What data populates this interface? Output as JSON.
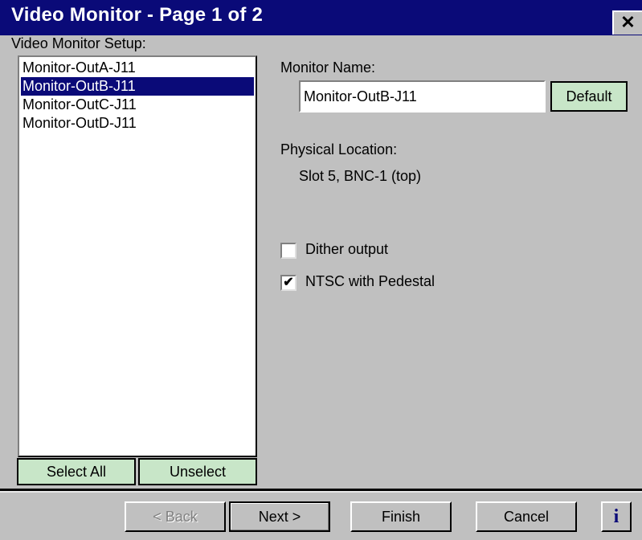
{
  "window": {
    "title": "Video Monitor - Page 1 of 2",
    "close_glyph": "✕"
  },
  "setup": {
    "label": "Video Monitor Setup:",
    "items": [
      "Monitor-OutA-J11",
      "Monitor-OutB-J11",
      "Monitor-OutC-J11",
      "Monitor-OutD-J11"
    ],
    "selected_index": 1,
    "select_all_label": "Select All",
    "unselect_label": "Unselect"
  },
  "monitor": {
    "name_label": "Monitor Name:",
    "name_value": "Monitor-OutB-J11",
    "default_label": "Default",
    "location_label": "Physical Location:",
    "location_value": "Slot 5, BNC-1 (top)"
  },
  "options": {
    "dither": {
      "label": "Dither output",
      "checked": false
    },
    "ntsc": {
      "label": "NTSC with Pedestal",
      "checked": true
    }
  },
  "nav": {
    "back_label": "< Back",
    "next_label": "Next >",
    "finish_label": "Finish",
    "cancel_label": "Cancel",
    "info_glyph": "i"
  },
  "colors": {
    "selection": "#0a0a78",
    "green_button": "#c8e6c8",
    "dialog_bg": "#c0c0c0"
  }
}
